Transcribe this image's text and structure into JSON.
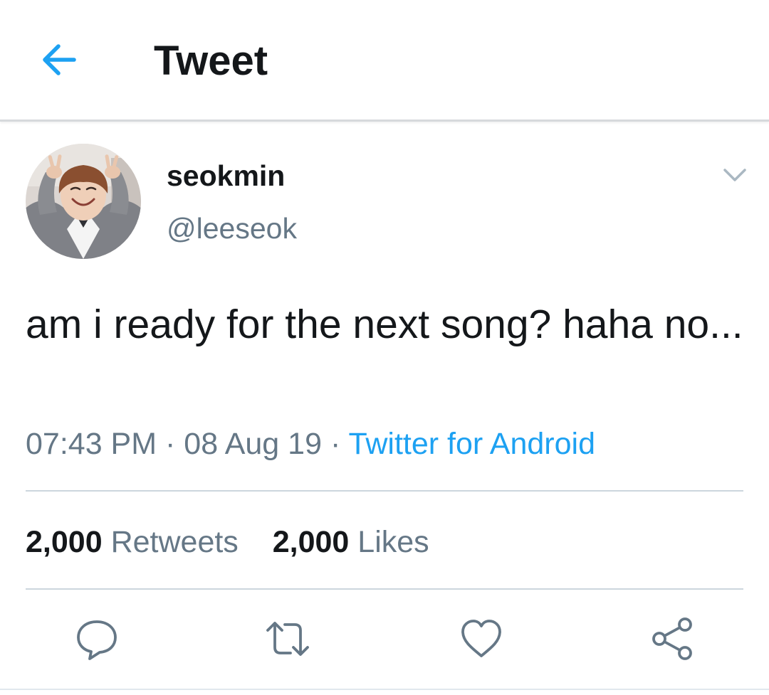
{
  "header": {
    "title": "Tweet",
    "back_icon": "arrow-left-icon"
  },
  "tweet": {
    "author": {
      "display_name": "seokmin",
      "handle": "@leeseok"
    },
    "text": "am i ready for the next song? haha no...",
    "time": "07:43 PM",
    "separator": "·",
    "date": "08 Aug 19",
    "source": "Twitter for Android",
    "stats": {
      "retweets_count": "2,000",
      "retweets_label": "Retweets",
      "likes_count": "2,000",
      "likes_label": "Likes"
    },
    "actions": [
      "reply-icon",
      "retweet-icon",
      "like-icon",
      "share-icon"
    ]
  },
  "colors": {
    "accent": "#1da1f2",
    "text_primary": "#14171a",
    "text_secondary": "#657786",
    "divider": "#ccd6dd"
  }
}
